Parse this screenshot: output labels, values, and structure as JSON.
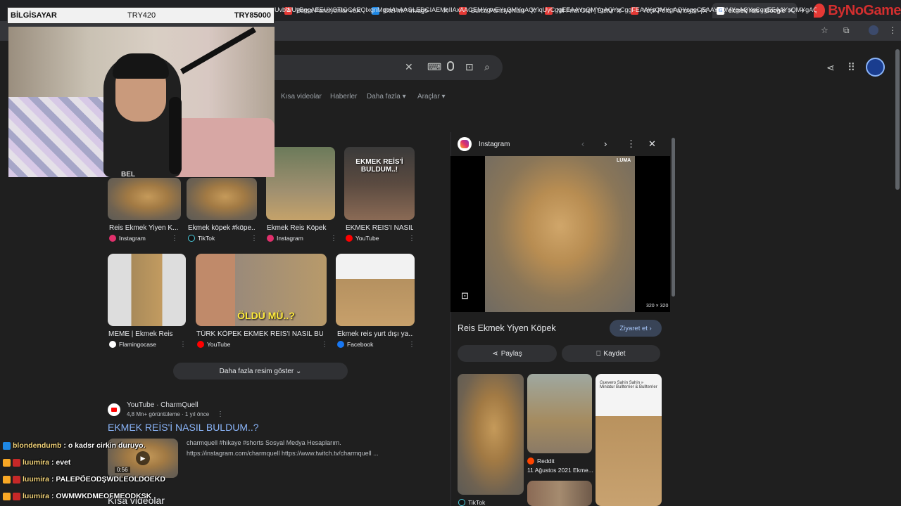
{
  "tabs": [
    {
      "label": "Bursa Pansiyonlar ve",
      "color": "#e53935",
      "glyph": "Z"
    },
    {
      "label": "Otel mi? trivago",
      "color": "#1e88e5",
      "glyph": ""
    },
    {
      "label": "Bursa Pansiyonları -",
      "color": "#e53935",
      "glyph": ""
    },
    {
      "label": "Nil Fırat Otel | Etstur",
      "color": "#e53935",
      "glyph": ""
    },
    {
      "label": "Yeşil Pera Pansiyon |",
      "color": "#e53935",
      "glyph": ""
    },
    {
      "label": "ekmek reis - Google",
      "color": "#ffffff",
      "glyph": "G"
    }
  ],
  "brand_logo": "ByNoGame",
  "address_bar": {
    "url": "UvbWUyBggAEEUYOTIGCAEQlxgnMgoIAhAAGLEDGIAEMhIIAxAAGEMYgwEYsQMYgAQYiqUyCggEEAAYsQMYgAQYqCggFEAAYsQMYgAQYcggGEAAYsQMYgAQYqCggEEAAYsQMYgAQYeggHEAAYQxiDARixAxiABBi..."
  },
  "webcam_overlay": {
    "left_label": "BİLGİSAYAR",
    "mid_label": "TRY420",
    "right_label": "TRY85000",
    "shirt_text": "BEL"
  },
  "filters": [
    "Kısa videolar",
    "Haberler",
    "Daha fazla ▾",
    "Araçlar ▾"
  ],
  "image_results_row1": [
    {
      "title": "Reis Ekmek Yiyen K...",
      "source": "Instagram",
      "source_color": "#e1306c",
      "overlay": ""
    },
    {
      "title": "Ekmek köpek #köpe...",
      "source": "TikTok",
      "source_color": "#111111",
      "overlay": ""
    },
    {
      "title": "Ekmek Reis Köpek",
      "source": "Instagram",
      "source_color": "#e1306c",
      "overlay": ""
    },
    {
      "title": "EKMEK REİS'İ NASIL...",
      "source": "YouTube",
      "source_color": "#ff0000",
      "overlay": "EKMEK REİS'İ BULDUM..!"
    }
  ],
  "image_results_row2": [
    {
      "title": "MEME | Ekmek Reis",
      "source": "Flamingocase",
      "source_color": "#ffffff",
      "overlay": ""
    },
    {
      "title": "TÜRK KÖPEK EKMEK REİS'İ NASIL BU...",
      "source": "YouTube",
      "source_color": "#ff0000",
      "overlay": "ÖLDÜ MÜ..?"
    },
    {
      "title": "Ekmek reis yurt dışı ya...",
      "source": "Facebook",
      "source_color": "#1877f2",
      "overlay": ""
    }
  ],
  "more_images_label": "Daha fazla resim göster ⌄",
  "video_result": {
    "source": "YouTube · CharmQuell",
    "meta": "4,8 Mn+ görüntüleme · 1 yıl önce",
    "title": "EKMEK REİS'İ NASIL BULDUM..?",
    "duration": "0:56",
    "description": "charmquell #hikaye #shorts Sosyal Medya Hesaplarım. https://instagram.com/charmquell https://www.twitch.tv/charmquell ..."
  },
  "shorts_heading": "Kısa videolar",
  "chat": [
    {
      "user": "blondendumb",
      "message": ": o kadsr cirkin duruyo.",
      "badge_color": "#1e88e5"
    },
    {
      "user": "luumira",
      "message": ": evet",
      "badge_color": "#f9a825"
    },
    {
      "user": "luumira",
      "message": ": PALEPÖEODŞWDLEOLDOEKD",
      "badge_color": "#f9a825"
    },
    {
      "user": "luumira",
      "message": ": OWMWKDMEOFMEODKSK",
      "badge_color": "#f9a825"
    }
  ],
  "panel": {
    "source": "Instagram",
    "watermark": "LUMA",
    "image_size": "320 × 320",
    "title": "Reis Ekmek Yiyen Köpek",
    "visit_label": "Ziyaret et ›",
    "share_label": "Paylaş",
    "save_label": "Kaydet",
    "related": [
      {
        "source": "TikTok",
        "caption": ""
      },
      {
        "source": "Reddit",
        "caption": "11 Ağustos 2021 Ekme..."
      },
      {
        "source": "",
        "caption": ""
      }
    ],
    "related_text_overlay": "Guevero Sahin Sahin »  Minlatur Bullterrier & Bullterrier"
  },
  "icons": {
    "clear": "✕",
    "keyboard": "⌨",
    "mic": "🎙",
    "lens": "◎",
    "search": "🔍",
    "share": "⋖",
    "apps": "⋮⋮⋮",
    "back": "‹",
    "forward": "›",
    "more": "⋮",
    "close": "✕"
  }
}
